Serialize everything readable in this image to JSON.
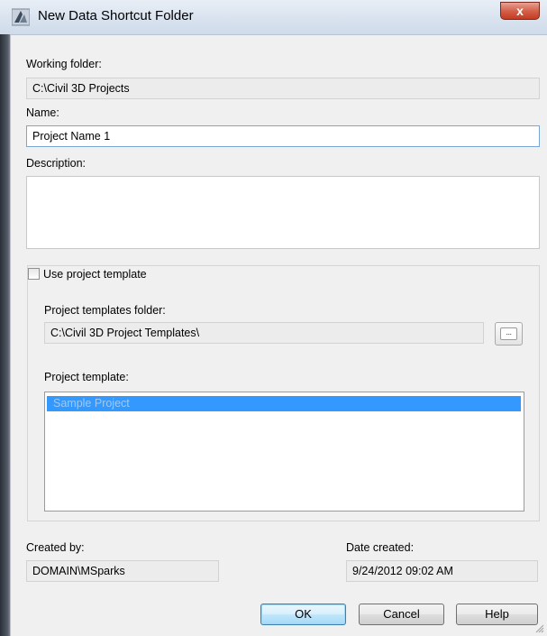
{
  "window": {
    "title": "New Data Shortcut Folder",
    "close_label": "x"
  },
  "form": {
    "working_folder": {
      "label": "Working folder:",
      "value": "C:\\Civil 3D Projects"
    },
    "name": {
      "label": "Name:",
      "value": "Project Name 1"
    },
    "description": {
      "label": "Description:",
      "value": ""
    }
  },
  "template_group": {
    "use_template_label": "Use project template",
    "use_template_checked": false,
    "templates_folder": {
      "label": "Project templates folder:",
      "value": "C:\\Civil 3D Project Templates\\"
    },
    "browse_label": "...",
    "project_template": {
      "label": "Project template:",
      "items": [
        "Sample Project"
      ],
      "selected_index": 0
    }
  },
  "info": {
    "created_by": {
      "label": "Created by:",
      "value": "DOMAIN\\MSparks"
    },
    "date_created": {
      "label": "Date created:",
      "value": "9/24/2012 09:02 AM"
    }
  },
  "buttons": {
    "ok": "OK",
    "cancel": "Cancel",
    "help": "Help"
  },
  "icons": {
    "app": "autocad-civil3d-icon",
    "close": "close-icon",
    "browse": "ellipsis-icon"
  }
}
